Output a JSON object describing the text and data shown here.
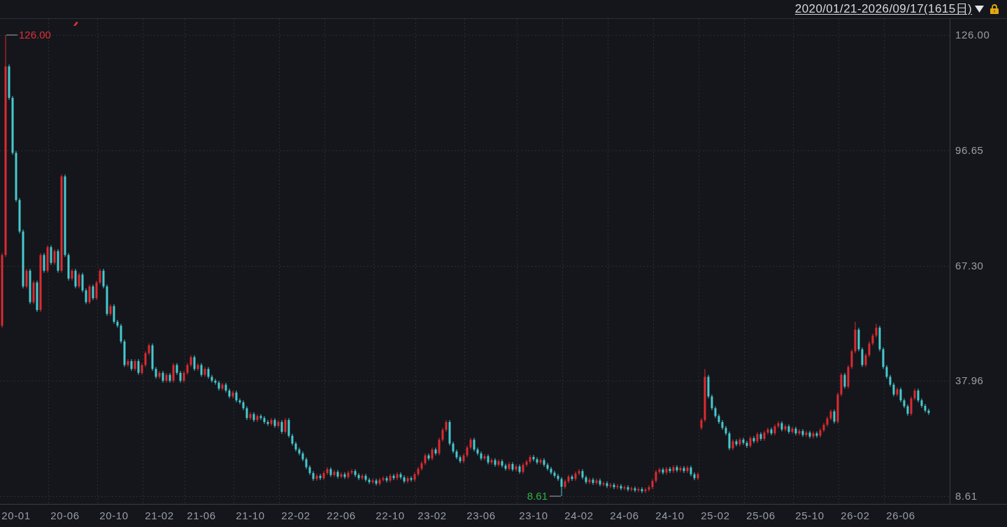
{
  "header": {
    "date_range": "2020/01/21-2026/09/17(1615日)"
  },
  "chart": {
    "chart_data": {
      "type": "candlestick",
      "grid": true,
      "categories": [
        null,
        null,
        null,
        null,
        "20-01",
        null,
        null,
        null,
        null,
        null,
        null,
        null,
        null,
        null,
        null,
        null,
        null,
        null,
        "20-06",
        null,
        null,
        null,
        null,
        null,
        null,
        null,
        null,
        null,
        null,
        null,
        null,
        null,
        "20-10",
        null,
        null,
        null,
        null,
        null,
        null,
        null,
        null,
        null,
        null,
        null,
        null,
        "21-02",
        null,
        null,
        null,
        null,
        null,
        null,
        null,
        null,
        null,
        null,
        null,
        "21-06",
        null,
        null,
        null,
        null,
        null,
        null,
        null,
        null,
        null,
        null,
        null,
        null,
        null,
        "21-10",
        null,
        null,
        null,
        null,
        null,
        null,
        null,
        null,
        null,
        null,
        null,
        null,
        "22-02",
        null,
        null,
        null,
        null,
        null,
        null,
        null,
        null,
        null,
        null,
        null,
        null,
        "22-06",
        null,
        null,
        null,
        null,
        null,
        null,
        null,
        null,
        null,
        null,
        null,
        null,
        null,
        "22-10",
        null,
        null,
        null,
        null,
        null,
        null,
        null,
        null,
        null,
        null,
        null,
        "23-02",
        null,
        null,
        null,
        null,
        null,
        null,
        null,
        null,
        null,
        null,
        null,
        null,
        null,
        "23-06",
        null,
        null,
        null,
        null,
        null,
        null,
        null,
        null,
        null,
        null,
        null,
        null,
        null,
        null,
        "23-10",
        null,
        null,
        null,
        null,
        null,
        null,
        null,
        null,
        null,
        null,
        null,
        null,
        "24-02",
        null,
        null,
        null,
        null,
        null,
        null,
        null,
        null,
        null,
        null,
        null,
        null,
        "24-06",
        null,
        null,
        null,
        null,
        null,
        null,
        null,
        null,
        null,
        null,
        null,
        null,
        "24-10",
        null,
        null,
        null,
        null,
        null,
        null,
        null,
        null,
        null,
        null,
        null,
        null,
        "25-02",
        null,
        null,
        null,
        null,
        null,
        null,
        null,
        null,
        null,
        null,
        null,
        null,
        "25-06",
        null,
        null,
        null,
        null,
        null,
        null,
        null,
        null,
        null,
        null,
        null,
        null,
        null,
        "25-10",
        null,
        null,
        null,
        null,
        null,
        null,
        null,
        null,
        null,
        null,
        null,
        null,
        "26-02",
        null,
        null,
        null,
        null,
        null,
        null,
        null,
        null,
        null,
        null,
        null,
        null,
        "26-06",
        null,
        null,
        null,
        null,
        null,
        null,
        null,
        null
      ],
      "ohlc": [
        [
          52,
          70.5,
          51.5,
          70
        ],
        [
          70,
          126,
          69.5,
          118
        ],
        [
          118,
          118.5,
          109.5,
          110
        ],
        [
          110,
          110.5,
          95.5,
          96
        ],
        [
          96,
          96.5,
          83.5,
          84
        ],
        [
          84,
          84.5,
          75.5,
          76
        ],
        [
          76,
          76.5,
          61.5,
          62
        ],
        [
          62,
          66.5,
          61.5,
          66
        ],
        [
          66,
          66.5,
          57.5,
          58
        ],
        [
          58,
          63.5,
          57.5,
          63
        ],
        [
          63,
          63.5,
          55.5,
          56
        ],
        [
          56,
          70.5,
          55.5,
          70
        ],
        [
          70,
          70.5,
          65.5,
          66
        ],
        [
          66,
          72.5,
          65.5,
          72
        ],
        [
          72,
          72.5,
          67.5,
          68
        ],
        [
          68,
          71.5,
          67.5,
          71
        ],
        [
          71,
          71.5,
          65.5,
          66
        ],
        [
          66,
          90.5,
          65.5,
          90
        ],
        [
          90,
          90.5,
          69.5,
          70
        ],
        [
          70,
          70.5,
          63.5,
          64
        ],
        [
          64,
          66.5,
          63.5,
          66
        ],
        [
          66,
          66.5,
          61.5,
          62
        ],
        [
          62,
          65.5,
          61.5,
          65
        ],
        [
          65,
          65.5,
          60.5,
          61
        ],
        [
          61,
          61.5,
          57.5,
          58
        ],
        [
          58,
          62.5,
          57.5,
          62
        ],
        [
          62,
          62.5,
          58.5,
          59
        ],
        [
          59,
          63.5,
          58.5,
          63
        ],
        [
          63,
          66.5,
          62.5,
          66
        ],
        [
          66,
          66.5,
          61.5,
          62
        ],
        [
          62,
          62.5,
          54.5,
          55
        ],
        [
          55,
          57.5,
          54.5,
          57
        ],
        [
          57,
          57.5,
          52.5,
          53
        ],
        [
          53,
          53.5,
          51.5,
          52
        ],
        [
          52,
          52.5,
          47.5,
          48
        ],
        [
          48,
          48.5,
          41.5,
          42
        ],
        [
          42,
          43.5,
          41.5,
          43
        ],
        [
          43,
          43.5,
          40.5,
          41
        ],
        [
          41,
          43.5,
          40.5,
          43
        ],
        [
          43,
          43.5,
          39.5,
          40
        ],
        [
          40,
          42.5,
          39.5,
          42
        ],
        [
          42,
          45.5,
          41.5,
          45
        ],
        [
          45,
          47.5,
          44.5,
          47
        ],
        [
          47,
          47.5,
          40.5,
          41
        ],
        [
          41,
          41.5,
          38.5,
          39
        ],
        [
          39,
          40.5,
          38.5,
          40
        ],
        [
          40,
          40.5,
          37.5,
          38
        ],
        [
          38,
          40,
          37.5,
          39.5
        ],
        [
          39.5,
          40,
          37.5,
          38
        ],
        [
          38,
          42.5,
          37.5,
          42
        ],
        [
          42,
          42.5,
          39.5,
          40
        ],
        [
          40,
          40.5,
          37.5,
          38
        ],
        [
          38,
          40.5,
          37.5,
          40
        ],
        [
          40,
          42.5,
          39.5,
          42
        ],
        [
          42,
          44.5,
          41.5,
          44
        ],
        [
          44,
          44.5,
          40.5,
          41
        ],
        [
          41,
          42.5,
          40.5,
          42
        ],
        [
          42,
          42.5,
          39,
          39.5
        ],
        [
          39.5,
          41.5,
          39,
          41
        ],
        [
          41,
          41.5,
          38.5,
          39
        ],
        [
          39,
          39.5,
          37.5,
          38
        ],
        [
          38,
          38.5,
          37,
          37.5
        ],
        [
          37.5,
          38,
          35.5,
          36
        ],
        [
          36,
          37.5,
          35.5,
          37
        ],
        [
          37,
          37.5,
          35,
          35.5
        ],
        [
          35.5,
          36,
          33.5,
          34
        ],
        [
          34,
          35.5,
          33.5,
          35
        ],
        [
          35,
          35.5,
          32.5,
          33
        ],
        [
          33,
          33.5,
          32,
          32.5
        ],
        [
          32.5,
          33,
          30.5,
          31
        ],
        [
          31,
          31.5,
          28,
          28.5
        ],
        [
          28.5,
          30,
          28,
          29.5
        ],
        [
          29.5,
          30,
          27.5,
          28
        ],
        [
          28,
          29.5,
          27.5,
          29
        ],
        [
          29,
          29.5,
          28,
          28.5
        ],
        [
          28.5,
          29,
          27,
          27.5
        ],
        [
          27.5,
          28,
          26.5,
          27
        ],
        [
          27,
          28.5,
          26.5,
          28
        ],
        [
          28,
          28.5,
          26,
          26.5
        ],
        [
          26.5,
          28,
          26,
          27.5
        ],
        [
          27.5,
          28,
          24.5,
          25
        ],
        [
          25,
          28.5,
          24.5,
          28
        ],
        [
          28,
          28.5,
          23.5,
          24
        ],
        [
          24,
          24.5,
          21.5,
          22
        ],
        [
          22,
          22.5,
          20,
          20.5
        ],
        [
          20.5,
          21,
          19,
          19.5
        ],
        [
          19.5,
          20,
          17.5,
          18
        ],
        [
          18,
          18.5,
          15.5,
          16
        ],
        [
          16,
          16.5,
          14,
          14.5
        ],
        [
          14.5,
          15,
          12.5,
          13
        ],
        [
          13,
          14.3,
          12.5,
          13.8
        ],
        [
          13.8,
          14.3,
          12.7,
          13.2
        ],
        [
          13.2,
          15,
          12.7,
          14.5
        ],
        [
          14.5,
          16,
          14,
          15.5
        ],
        [
          15.5,
          16,
          13.5,
          14
        ],
        [
          14,
          15.3,
          13.5,
          14.8
        ],
        [
          14.8,
          15.3,
          13.1,
          13.6
        ],
        [
          13.6,
          14.7,
          13.1,
          14.2
        ],
        [
          14.2,
          14.7,
          13,
          13.5
        ],
        [
          13.5,
          15.1,
          13,
          14.6
        ],
        [
          14.6,
          15.5,
          14.1,
          15
        ],
        [
          15,
          15.5,
          13.5,
          14
        ],
        [
          14,
          14.5,
          12.7,
          13.2
        ],
        [
          13.2,
          14.3,
          12.7,
          13.8
        ],
        [
          13.8,
          14.3,
          12.3,
          12.8
        ],
        [
          12.8,
          13.3,
          11.7,
          12.2
        ],
        [
          12.2,
          13.1,
          11.7,
          12.6
        ],
        [
          12.6,
          13.1,
          11.3,
          11.8
        ],
        [
          11.8,
          13.3,
          11.3,
          12.8
        ],
        [
          12.8,
          13.7,
          12.3,
          13.2
        ],
        [
          13.2,
          13.7,
          12.1,
          12.6
        ],
        [
          12.6,
          14.3,
          12.1,
          13.8
        ],
        [
          13.8,
          14.3,
          12.7,
          13.2
        ],
        [
          13.2,
          14.7,
          12.7,
          14.2
        ],
        [
          14.2,
          14.7,
          12.9,
          13.4
        ],
        [
          13.4,
          13.9,
          11.9,
          12.4
        ],
        [
          12.4,
          13.7,
          11.9,
          13.2
        ],
        [
          13.2,
          13.7,
          12.3,
          12.8
        ],
        [
          12.8,
          14.7,
          12.3,
          14.2
        ],
        [
          14.2,
          16.1,
          13.7,
          15.6
        ],
        [
          15.6,
          17.5,
          15.1,
          17
        ],
        [
          17,
          19.5,
          16.5,
          19
        ],
        [
          19,
          19.5,
          17.7,
          18.2
        ],
        [
          18.2,
          21,
          17.7,
          20.5
        ],
        [
          20.5,
          21,
          19,
          19.5
        ],
        [
          19.5,
          23.5,
          19,
          23
        ],
        [
          23,
          26,
          22.5,
          25.5
        ],
        [
          25.5,
          28,
          25,
          27.5
        ],
        [
          27.5,
          28,
          21.5,
          22
        ],
        [
          22,
          22.5,
          19.5,
          20
        ],
        [
          20,
          20.5,
          18,
          18.5
        ],
        [
          18.5,
          19,
          17,
          17.5
        ],
        [
          17.5,
          19.5,
          17,
          19
        ],
        [
          19,
          21.5,
          18.5,
          21
        ],
        [
          21,
          23.5,
          20.5,
          23
        ],
        [
          23,
          23.5,
          20,
          20.5
        ],
        [
          20.5,
          21,
          19,
          19.5
        ],
        [
          19.5,
          20,
          17.7,
          18.2
        ],
        [
          18.2,
          19.3,
          17.7,
          18.8
        ],
        [
          18.8,
          19.3,
          16.7,
          17.2
        ],
        [
          17.2,
          18.3,
          16.7,
          17.8
        ],
        [
          17.8,
          18.3,
          16.1,
          16.6
        ],
        [
          16.6,
          18,
          16.1,
          17.5
        ],
        [
          17.5,
          18,
          15.9,
          16.4
        ],
        [
          16.4,
          16.9,
          15.1,
          15.6
        ],
        [
          15.6,
          17.3,
          15.1,
          16.8
        ],
        [
          16.8,
          17.3,
          14.9,
          15.4
        ],
        [
          15.4,
          16.7,
          14.9,
          16.2
        ],
        [
          16.2,
          16.7,
          14.3,
          14.8
        ],
        [
          14.8,
          17.1,
          14.3,
          16.6
        ],
        [
          16.6,
          17.9,
          16.1,
          17.4
        ],
        [
          17.4,
          19.1,
          16.9,
          18.6
        ],
        [
          18.6,
          19.1,
          17.5,
          18
        ],
        [
          18,
          18.5,
          16.7,
          17.2
        ],
        [
          17.2,
          18.3,
          16.7,
          17.8
        ],
        [
          17.8,
          18.3,
          16.1,
          16.6
        ],
        [
          16.6,
          17.1,
          15.1,
          15.6
        ],
        [
          15.6,
          16.1,
          14.1,
          14.6
        ],
        [
          14.6,
          15.1,
          13.3,
          13.8
        ],
        [
          13.8,
          14.3,
          12.5,
          13
        ],
        [
          13,
          13.5,
          8.61,
          11
        ],
        [
          11,
          12.9,
          10.5,
          12.4
        ],
        [
          12.4,
          14.1,
          11.9,
          13.6
        ],
        [
          13.6,
          14.1,
          12.5,
          13
        ],
        [
          13,
          14.9,
          12.5,
          14.4
        ],
        [
          14.4,
          15.5,
          13.9,
          15
        ],
        [
          15,
          15.5,
          12.9,
          13.4
        ],
        [
          13.4,
          13.9,
          11.7,
          12.2
        ],
        [
          12.2,
          13.3,
          11.7,
          12.8
        ],
        [
          12.8,
          13.3,
          11.5,
          12
        ],
        [
          12,
          13.1,
          11.5,
          12.6
        ],
        [
          12.6,
          13.1,
          11.1,
          11.6
        ],
        [
          11.6,
          12.4,
          11.1,
          11.9
        ],
        [
          11.9,
          12.4,
          10.7,
          11.2
        ],
        [
          11.2,
          12,
          10.7,
          11.5
        ],
        [
          11.5,
          12,
          10.4,
          10.9
        ],
        [
          10.9,
          11.7,
          10.4,
          11.2
        ],
        [
          11.2,
          11.7,
          10.1,
          10.6
        ],
        [
          10.6,
          11.4,
          10.1,
          10.9
        ],
        [
          10.9,
          11.4,
          9.8,
          10.3
        ],
        [
          10.3,
          11.1,
          9.8,
          10.6
        ],
        [
          10.6,
          11.1,
          9.6,
          10.1
        ],
        [
          10.1,
          10.9,
          9.6,
          10.4
        ],
        [
          10.4,
          10.9,
          9.4,
          9.9
        ],
        [
          9.9,
          10.8,
          9.4,
          10.3
        ],
        [
          10.3,
          11.4,
          9.8,
          10.9
        ],
        [
          10.9,
          13,
          10.4,
          12.5
        ],
        [
          12.5,
          15.3,
          12,
          14.8
        ],
        [
          14.8,
          15.9,
          14.3,
          15.4
        ],
        [
          15.4,
          15.9,
          14.1,
          14.6
        ],
        [
          14.6,
          16.1,
          14.1,
          15.6
        ],
        [
          15.6,
          16.1,
          14.5,
          15
        ],
        [
          15,
          16.5,
          14.5,
          16
        ],
        [
          16,
          16.5,
          14.7,
          15.2
        ],
        [
          15.2,
          16.3,
          14.7,
          15.8
        ],
        [
          15.8,
          16.3,
          14.5,
          15
        ],
        [
          15,
          16.4,
          14.5,
          15.9
        ],
        [
          15.9,
          16.4,
          13.7,
          14.2
        ],
        [
          14.2,
          14.7,
          12.7,
          13.2
        ],
        [
          13.2,
          14.7,
          12.7,
          14.2
        ],
        [
          26,
          28.5,
          25.5,
          28
        ],
        [
          28,
          41,
          27.5,
          39
        ],
        [
          39,
          39.5,
          33.5,
          34
        ],
        [
          34,
          34.5,
          30.5,
          31
        ],
        [
          31,
          31.5,
          28.5,
          29
        ],
        [
          29,
          29.5,
          27,
          27.5
        ],
        [
          27.5,
          28,
          25.5,
          26
        ],
        [
          26,
          26.5,
          24.1,
          24.6
        ],
        [
          24.6,
          25.1,
          20.3,
          20.8
        ],
        [
          20.8,
          23.1,
          20.3,
          22.6
        ],
        [
          22.6,
          23.1,
          21.3,
          21.8
        ],
        [
          21.8,
          23.5,
          21.3,
          23
        ],
        [
          23,
          23.5,
          21.7,
          22.2
        ],
        [
          22.2,
          22.7,
          20.9,
          21.4
        ],
        [
          21.4,
          23.9,
          20.9,
          23.4
        ],
        [
          23.4,
          23.9,
          22.1,
          22.6
        ],
        [
          22.6,
          24.9,
          22.1,
          24.4
        ],
        [
          24.4,
          24.9,
          22.7,
          23.2
        ],
        [
          23.2,
          25.3,
          22.7,
          24.8
        ],
        [
          24.8,
          26.1,
          24.3,
          25.6
        ],
        [
          25.6,
          26.1,
          24.1,
          24.6
        ],
        [
          24.6,
          26.9,
          24.1,
          26.4
        ],
        [
          26.4,
          27.7,
          25.9,
          27.2
        ],
        [
          27.2,
          27.7,
          25.1,
          25.6
        ],
        [
          25.6,
          26.9,
          25.1,
          26.4
        ],
        [
          26.4,
          26.9,
          24.5,
          25
        ],
        [
          25,
          26.3,
          24.5,
          25.8
        ],
        [
          25.8,
          26.3,
          24.1,
          24.6
        ],
        [
          24.6,
          25.7,
          24.1,
          25.2
        ],
        [
          25.2,
          25.7,
          23.7,
          24.2
        ],
        [
          24.2,
          25.3,
          23.7,
          24.8
        ],
        [
          24.8,
          25.3,
          23.3,
          23.8
        ],
        [
          23.8,
          25.1,
          23.3,
          24.6
        ],
        [
          24.6,
          25.1,
          23.5,
          24
        ],
        [
          24,
          25.9,
          23.5,
          25.4
        ],
        [
          25.4,
          27.3,
          24.9,
          26.8
        ],
        [
          26.8,
          28.9,
          26.3,
          28.4
        ],
        [
          28.4,
          30.7,
          27.9,
          30.2
        ],
        [
          30.2,
          30.7,
          27.1,
          27.6
        ],
        [
          27.6,
          35,
          27.1,
          34.5
        ],
        [
          34.5,
          40,
          34,
          39.5
        ],
        [
          39.5,
          40,
          36,
          36.5
        ],
        [
          36.5,
          42,
          36,
          41.5
        ],
        [
          41.5,
          46,
          41,
          45.5
        ],
        [
          45.5,
          53,
          45,
          51
        ],
        [
          51,
          51.5,
          45.5,
          46
        ],
        [
          46,
          46.5,
          41.5,
          42
        ],
        [
          42,
          45,
          41.5,
          44.5
        ],
        [
          44.5,
          48,
          44,
          47.5
        ],
        [
          47.5,
          50,
          47,
          49.5
        ],
        [
          49.5,
          52.5,
          49,
          51.5
        ],
        [
          51.5,
          52,
          45.5,
          46
        ],
        [
          46,
          46.5,
          41,
          41.5
        ],
        [
          41.5,
          42,
          38.5,
          39
        ],
        [
          39,
          39.5,
          36.5,
          37
        ],
        [
          37,
          37.5,
          34,
          34.5
        ],
        [
          34.5,
          36.3,
          34,
          35.8
        ],
        [
          35.8,
          36.3,
          32.5,
          33
        ],
        [
          33,
          33.5,
          31,
          31.5
        ],
        [
          31.5,
          32,
          29.1,
          29.6
        ],
        [
          29.6,
          34,
          29.1,
          33.5
        ],
        [
          33.5,
          36,
          33,
          35.5
        ],
        [
          35.5,
          36,
          32.5,
          33
        ],
        [
          33,
          33.5,
          31.1,
          31.6
        ],
        [
          31.6,
          32.1,
          29.9,
          30.4
        ],
        [
          30.4,
          30.9,
          29.3,
          29.8
        ]
      ],
      "ylim": [
        6.65,
        130.1
      ],
      "yticks": [
        {
          "value": 126,
          "label": "126.00"
        },
        {
          "value": 96.65,
          "label": "96.65"
        },
        {
          "value": 67.3,
          "label": "67.30"
        },
        {
          "value": 37.96,
          "label": "37.96"
        },
        {
          "value": 8.61,
          "label": "8.61"
        }
      ],
      "annotations": [
        "126.00",
        "8.61"
      ]
    }
  }
}
